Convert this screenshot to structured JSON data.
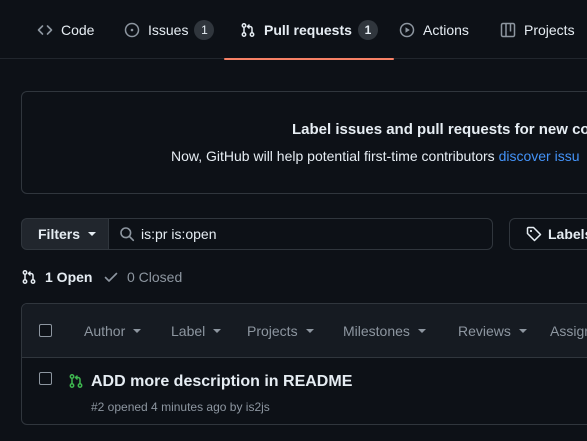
{
  "nav": {
    "tabs": [
      {
        "label": "Code",
        "icon": "code-icon"
      },
      {
        "label": "Issues",
        "icon": "issue-opened-icon",
        "count": "1"
      },
      {
        "label": "Pull requests",
        "icon": "git-pull-request-icon",
        "count": "1",
        "selected": true
      },
      {
        "label": "Actions",
        "icon": "play-icon"
      },
      {
        "label": "Projects",
        "icon": "table-icon"
      }
    ]
  },
  "banner": {
    "title": "Label issues and pull requests for new co",
    "text": "Now, GitHub will help potential first-time contributors ",
    "link": "discover issu"
  },
  "filter_bar": {
    "filters_label": "Filters",
    "search_value": "is:pr is:open",
    "labels_label": "Labels"
  },
  "states": {
    "open_label": "1 Open",
    "closed_label": "0 Closed"
  },
  "table_header": {
    "author": "Author",
    "label": "Label",
    "projects": "Projects",
    "milestones": "Milestones",
    "reviews": "Reviews",
    "assignee": "Assign"
  },
  "pull_requests": [
    {
      "title": "ADD more description in README",
      "meta": "#2 opened 4 minutes ago by is2js"
    }
  ],
  "colors": {
    "background": "#0d1117",
    "border": "#30363d",
    "selected_underline": "#f78166",
    "link": "#4493f8",
    "open_green": "#3fb950",
    "muted_text": "#8d96a0"
  }
}
